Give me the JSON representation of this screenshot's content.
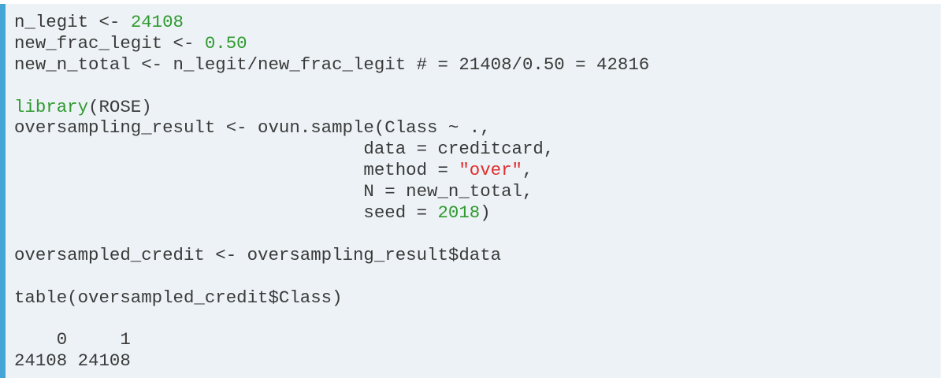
{
  "colors": {
    "background": "#ecf2f5",
    "left_border": "#45a6d6",
    "text": "#3a3a3a",
    "number": "#2f9a2f",
    "string": "#e02d2d",
    "keyword": "#2f9a2f"
  },
  "code": {
    "l1": {
      "a": "n_legit <- ",
      "b": "24108"
    },
    "l2": {
      "a": "new_frac_legit <- ",
      "b": "0.50"
    },
    "l3": {
      "a": "new_n_total <- n_legit/new_frac_legit # = 21408/0.50 = 42816"
    },
    "l5": {
      "a": "library",
      "b": "(ROSE)"
    },
    "l6": {
      "a": "oversampling_result <- ovun.sample(Class ~ .,"
    },
    "l7": {
      "a": "                                 data = creditcard,"
    },
    "l8": {
      "a": "                                 method = ",
      "b": "\"over\"",
      "c": ","
    },
    "l9": {
      "a": "                                 N = new_n_total,"
    },
    "l10": {
      "a": "                                 seed = ",
      "b": "2018",
      "c": ")"
    },
    "l12": {
      "a": "oversampled_credit <- oversampling_result$data"
    },
    "l14": {
      "a": "table(oversampled_credit$Class)"
    },
    "l16": {
      "a": "    0     1 "
    },
    "l17": {
      "a": "24108 24108 "
    }
  }
}
